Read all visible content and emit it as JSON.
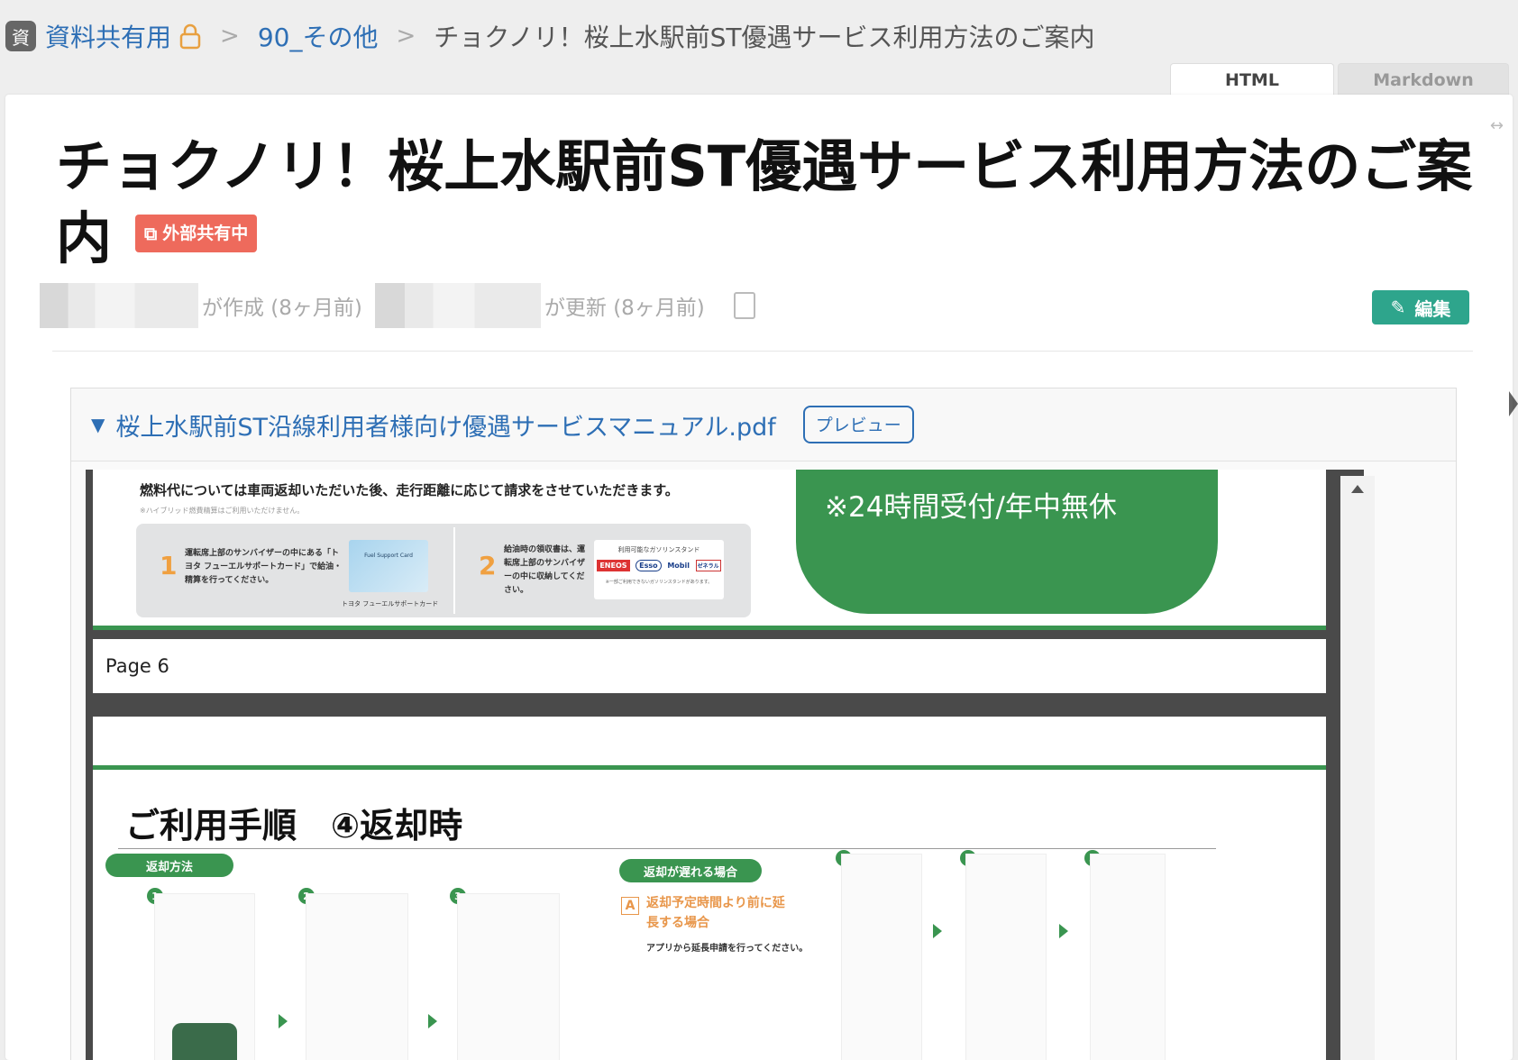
{
  "breadcrumb": {
    "badge": "資",
    "space": "資料共有用",
    "folder": "90_その他",
    "current": "チョクノリ！桜上水駅前ST優遇サービス利用方法のご案内",
    "separator": ">"
  },
  "tabs": [
    {
      "label": "HTML",
      "active": true
    },
    {
      "label": "Markdown",
      "active": false
    }
  ],
  "page": {
    "title": "チョクノリ！桜上水駅前ST優遇サービス利用方法のご案内",
    "external_badge": "外部共有中",
    "created_text": "が作成 (8ヶ月前)",
    "updated_text": "が更新 (8ヶ月前)",
    "edit_label": "編集",
    "expand_icon": "↔"
  },
  "attachment": {
    "filename": "桜上水駅前ST沿線利用者様向け優遇サービスマニュアル.pdf",
    "preview_label": "プレビュー"
  },
  "pdf": {
    "page1": {
      "fuel_text": "燃料代については車両返却いただいた後、走行距離に応じて請求をさせていただきます。",
      "fuel_note": "※ハイブリッド燃費精算はご利用いただけません。",
      "step1_num": "1",
      "step1_text": "運転席上部のサンバイザーの中にある「トヨタ フューエルサポートカード」で給油・精算を行ってください。",
      "card_caption": "トヨタ フューエルサポートカード",
      "card_label": "Fuel Support Card",
      "step2_num": "2",
      "step2_text": "給油時の領収書は、運転席上部のサンバイザーの中に収納してください。",
      "station_caption": "利用可能なガソリンスタンド",
      "station_note": "※一部ご利用できないガソリンスタンドがあります。",
      "brands": [
        "ENEOS",
        "Esso",
        "Mobil",
        "ゼネラル"
      ],
      "banner_text": "※24時間受付/年中無休",
      "footer": "Page 6"
    },
    "page2": {
      "title": "ご利用手順　④返却時",
      "pill_return": "返却方法",
      "pill_late": "返却が遅れる場合",
      "late_label": "A",
      "late_heading": "返却予定時間より前に延長する場合",
      "late_sub": "アプリから延長申請を行ってください。",
      "steps": [
        "1",
        "2",
        "3",
        "1",
        "2",
        "3"
      ]
    }
  },
  "colors": {
    "link": "#2e6fb5",
    "accent_green": "#2ea58c",
    "badge_red": "#ee6a5c",
    "pdf_green": "#3a9550"
  }
}
